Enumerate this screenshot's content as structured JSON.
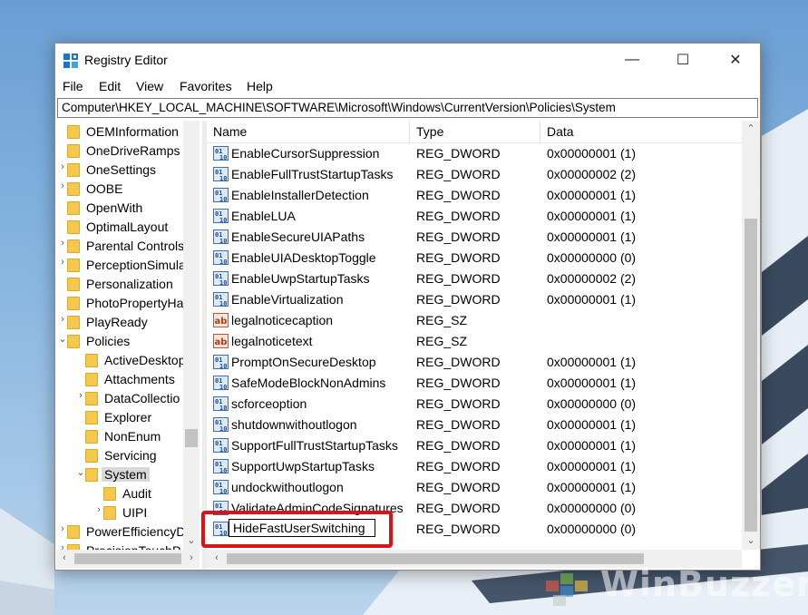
{
  "window": {
    "title": "Registry Editor",
    "minimize_glyph": "—",
    "maximize_glyph": "☐",
    "close_glyph": "✕"
  },
  "menu": [
    "File",
    "Edit",
    "View",
    "Favorites",
    "Help"
  ],
  "address": "Computer\\HKEY_LOCAL_MACHINE\\SOFTWARE\\Microsoft\\Windows\\CurrentVersion\\Policies\\System",
  "tree": [
    {
      "label": "OEMInformation",
      "expander": "",
      "level": 0
    },
    {
      "label": "OneDriveRamps",
      "expander": "",
      "level": 0
    },
    {
      "label": "OneSettings",
      "expander": "›",
      "level": 0
    },
    {
      "label": "OOBE",
      "expander": "›",
      "level": 0
    },
    {
      "label": "OpenWith",
      "expander": "",
      "level": 0
    },
    {
      "label": "OptimalLayout",
      "expander": "",
      "level": 0
    },
    {
      "label": "Parental Controls",
      "expander": "›",
      "level": 0
    },
    {
      "label": "PerceptionSimula",
      "expander": "›",
      "level": 0
    },
    {
      "label": "Personalization",
      "expander": "",
      "level": 0
    },
    {
      "label": "PhotoPropertyHa",
      "expander": "",
      "level": 0
    },
    {
      "label": "PlayReady",
      "expander": "›",
      "level": 0
    },
    {
      "label": "Policies",
      "expander": "⌄",
      "level": 0
    },
    {
      "label": "ActiveDesktop",
      "expander": "",
      "level": 1
    },
    {
      "label": "Attachments",
      "expander": "",
      "level": 1
    },
    {
      "label": "DataCollectio",
      "expander": "›",
      "level": 1
    },
    {
      "label": "Explorer",
      "expander": "",
      "level": 1
    },
    {
      "label": "NonEnum",
      "expander": "",
      "level": 1
    },
    {
      "label": "Servicing",
      "expander": "",
      "level": 1
    },
    {
      "label": "System",
      "expander": "⌄",
      "level": 1,
      "selected": true
    },
    {
      "label": "Audit",
      "expander": "",
      "level": 2
    },
    {
      "label": "UIPI",
      "expander": "›",
      "level": 2
    },
    {
      "label": "PowerEfficiencyD",
      "expander": "›",
      "level": 0
    },
    {
      "label": "PrecisionTouchP",
      "expander": "›",
      "level": 0
    }
  ],
  "columns": {
    "name": "Name",
    "type": "Type",
    "data": "Data"
  },
  "values": [
    {
      "name": "EnableCursorSuppression",
      "type": "REG_DWORD",
      "data": "0x00000001 (1)",
      "icon": "dword"
    },
    {
      "name": "EnableFullTrustStartupTasks",
      "type": "REG_DWORD",
      "data": "0x00000002 (2)",
      "icon": "dword"
    },
    {
      "name": "EnableInstallerDetection",
      "type": "REG_DWORD",
      "data": "0x00000001 (1)",
      "icon": "dword"
    },
    {
      "name": "EnableLUA",
      "type": "REG_DWORD",
      "data": "0x00000001 (1)",
      "icon": "dword"
    },
    {
      "name": "EnableSecureUIAPaths",
      "type": "REG_DWORD",
      "data": "0x00000001 (1)",
      "icon": "dword"
    },
    {
      "name": "EnableUIADesktopToggle",
      "type": "REG_DWORD",
      "data": "0x00000000 (0)",
      "icon": "dword"
    },
    {
      "name": "EnableUwpStartupTasks",
      "type": "REG_DWORD",
      "data": "0x00000002 (2)",
      "icon": "dword"
    },
    {
      "name": "EnableVirtualization",
      "type": "REG_DWORD",
      "data": "0x00000001 (1)",
      "icon": "dword"
    },
    {
      "name": "legalnoticecaption",
      "type": "REG_SZ",
      "data": "",
      "icon": "string"
    },
    {
      "name": "legalnoticetext",
      "type": "REG_SZ",
      "data": "",
      "icon": "string"
    },
    {
      "name": "PromptOnSecureDesktop",
      "type": "REG_DWORD",
      "data": "0x00000001 (1)",
      "icon": "dword"
    },
    {
      "name": "SafeModeBlockNonAdmins",
      "type": "REG_DWORD",
      "data": "0x00000001 (1)",
      "icon": "dword"
    },
    {
      "name": "scforceoption",
      "type": "REG_DWORD",
      "data": "0x00000000 (0)",
      "icon": "dword"
    },
    {
      "name": "shutdownwithoutlogon",
      "type": "REG_DWORD",
      "data": "0x00000001 (1)",
      "icon": "dword"
    },
    {
      "name": "SupportFullTrustStartupTasks",
      "type": "REG_DWORD",
      "data": "0x00000001 (1)",
      "icon": "dword"
    },
    {
      "name": "SupportUwpStartupTasks",
      "type": "REG_DWORD",
      "data": "0x00000001 (1)",
      "icon": "dword"
    },
    {
      "name": "undockwithoutlogon",
      "type": "REG_DWORD",
      "data": "0x00000001 (1)",
      "icon": "dword"
    },
    {
      "name": "ValidateAdminCodeSignatures",
      "type": "REG_DWORD",
      "data": "0x00000000 (0)",
      "icon": "dword"
    }
  ],
  "renaming": {
    "name": "HideFastUserSwitching",
    "type": "REG_DWORD",
    "data": "0x00000000 (0)"
  },
  "watermark": "WinBuzzer",
  "colors": {
    "highlight": "#d7141a",
    "folder": "#f3c84d",
    "selection": "#d9d9d9"
  }
}
